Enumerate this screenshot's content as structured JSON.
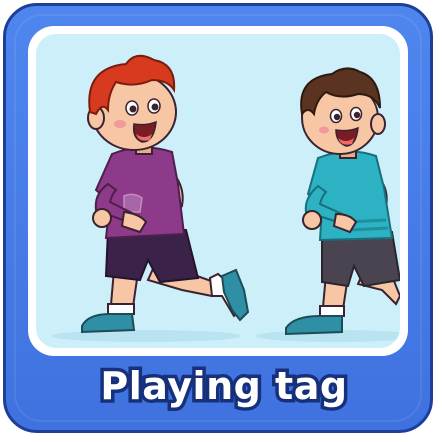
{
  "card": {
    "caption": "Playing tag",
    "accent_color": "#4a7fe8",
    "border_color": "#1d3f9a",
    "caption_outline_color": "#16307c",
    "picture_background": "#cdeffa"
  },
  "illustration": {
    "subject": "two-boys-running",
    "left_boy": {
      "hair_color": "#d73a1e",
      "shirt_color": "#8e3a8a",
      "shorts_color": "#3b2249",
      "shoe_color": "#2f8fa5"
    },
    "right_boy": {
      "hair_color": "#5a3321",
      "shirt_color": "#2db2c3",
      "shorts_color": "#4a4450",
      "shoe_color": "#2f8fa5"
    }
  }
}
